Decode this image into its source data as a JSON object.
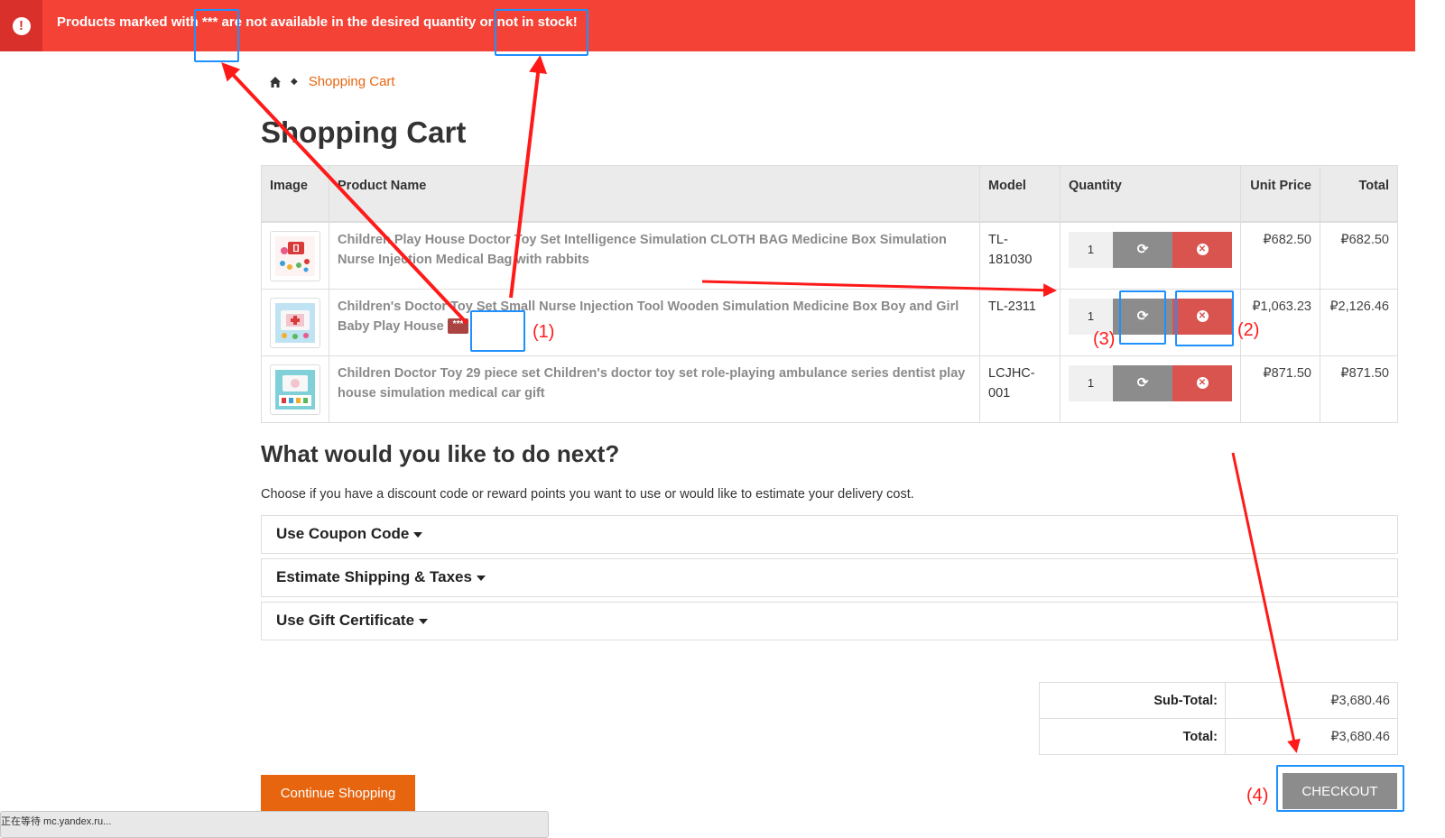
{
  "alert": {
    "icon": "exclamation-circle-icon",
    "message": "Products marked with *** are not available in the desired quantity or not in stock!"
  },
  "breadcrumb": {
    "home_icon": "home-icon",
    "separator": "◆",
    "current": "Shopping Cart"
  },
  "page": {
    "title": "Shopping Cart"
  },
  "cart": {
    "columns": {
      "image": "Image",
      "product_name": "Product Name",
      "model": "Model",
      "quantity": "Quantity",
      "unit_price": "Unit Price",
      "total": "Total"
    },
    "rows": [
      {
        "name": "Children Play House Doctor Toy Set Intelligence Simulation CLOTH BAG Medicine Box Simulation Nurse Injection Medical Bag with rabbits",
        "model": "TL-181030",
        "quantity": "1",
        "unit_price": "₽682.50",
        "total": "₽682.50"
      },
      {
        "name": "Children's Doctor Toy Set Small Nurse Injection Tool Wooden Simulation Medicine Box Boy and Girl Baby Play House",
        "stock_marker": "***",
        "model": "TL-2311",
        "quantity": "1",
        "unit_price": "₽1,063.23",
        "total": "₽2,126.46"
      },
      {
        "name": "Children Doctor Toy 29 piece set Children's doctor toy set role-playing ambulance series dentist play house simulation medical car gift",
        "model": "LCJHC-001",
        "quantity": "1",
        "unit_price": "₽871.50",
        "total": "₽871.50"
      }
    ],
    "update_icon": "refresh-icon",
    "remove_icon": "times-circle-icon"
  },
  "next": {
    "heading": "What would you like to do next?",
    "description": "Choose if you have a discount code or reward points you want to use or would like to estimate your delivery cost.",
    "panels": [
      {
        "title": "Use Coupon Code"
      },
      {
        "title": "Estimate Shipping & Taxes"
      },
      {
        "title": "Use Gift Certificate"
      }
    ]
  },
  "totals": {
    "subtotal_label": "Sub-Total:",
    "subtotal_value": "₽3,680.46",
    "total_label": "Total:",
    "total_value": "₽3,680.46"
  },
  "buttons": {
    "continue": "Continue Shopping",
    "checkout": "CHECKOUT"
  },
  "statusbar": {
    "text": "正在等待 mc.yandex.ru..."
  },
  "annotations": {
    "label_1": "(1)",
    "label_2": "(2)",
    "label_3": "(3)",
    "label_4": "(4)",
    "annotation_color": "#ff1a1a",
    "box_color": "#1e90ff"
  },
  "colors": {
    "alert_bg": "#f44336",
    "accent_orange": "#e8650f",
    "remove_red": "#d9534f",
    "update_gray": "#8c8c8c"
  }
}
